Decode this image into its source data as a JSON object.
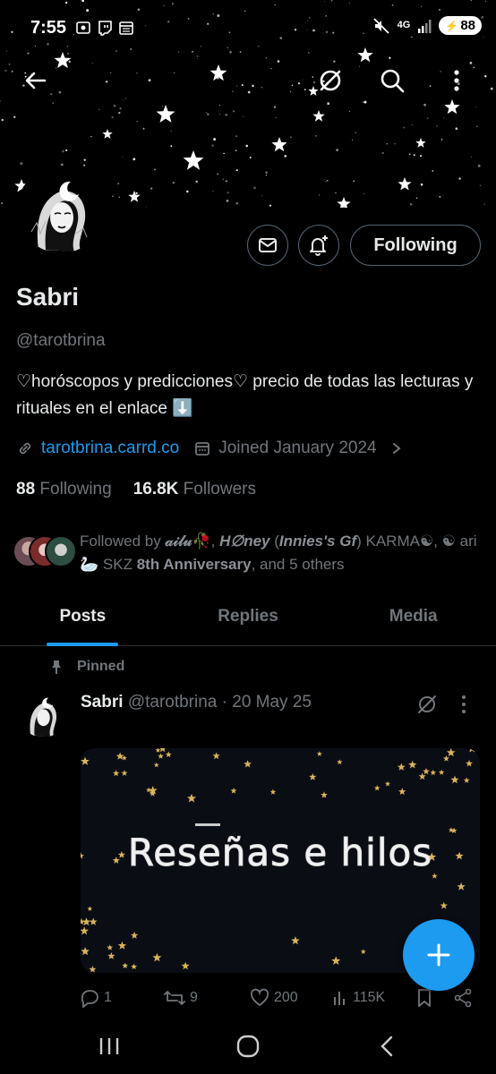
{
  "status_bar": {
    "time": "7:55",
    "network": "4G",
    "battery": "88"
  },
  "profile": {
    "name": "Sabri",
    "handle": "@tarotbrina",
    "bio": "♡horóscopos y predicciones♡ precio de todas las lecturas y rituales en el enlace ⬇️",
    "link": "tarotbrina.carrd.co",
    "joined": "Joined January 2024",
    "following_count": "88",
    "following_label": "Following",
    "followers_count": "16.8K",
    "followers_label": "Followers",
    "following_button": "Following"
  },
  "followed_by": {
    "prefix": "Followed by ",
    "name1": "𝒶𝒾𝓁𝓊🥀",
    "sep1": ", ",
    "name2": "H∅ney",
    "name2b": " (",
    "name2c": "Innies's Gf",
    "name2d": ") KARMA☯",
    "sep2": ", ",
    "name3": "☯ ari 🦢 SKZ ",
    "name3b": "8th Anniversary",
    "suffix": ", and 5 others"
  },
  "tabs": [
    {
      "label": "Posts",
      "active": true
    },
    {
      "label": "Replies",
      "active": false
    },
    {
      "label": "Media",
      "active": false
    }
  ],
  "post": {
    "pinned_label": "Pinned",
    "author": "Sabri",
    "meta": "@tarotbrina · 20 May 25",
    "media_title": "Reseñas e hilos",
    "replies": "1",
    "reposts": "9",
    "likes": "200",
    "views": "115K"
  },
  "colors": {
    "accent": "#1d9bf0",
    "muted": "#71767b",
    "text": "#e7e9ea",
    "border": "#536471"
  },
  "icons": [
    "back-arrow-icon",
    "grok-icon",
    "search-icon",
    "more-vertical-icon",
    "message-icon",
    "notification-bell-plus-icon",
    "link-icon",
    "calendar-icon",
    "chevron-right-icon",
    "pin-icon",
    "reply-icon",
    "repost-icon",
    "like-icon",
    "views-icon",
    "bookmark-icon",
    "share-icon",
    "plus-icon"
  ]
}
